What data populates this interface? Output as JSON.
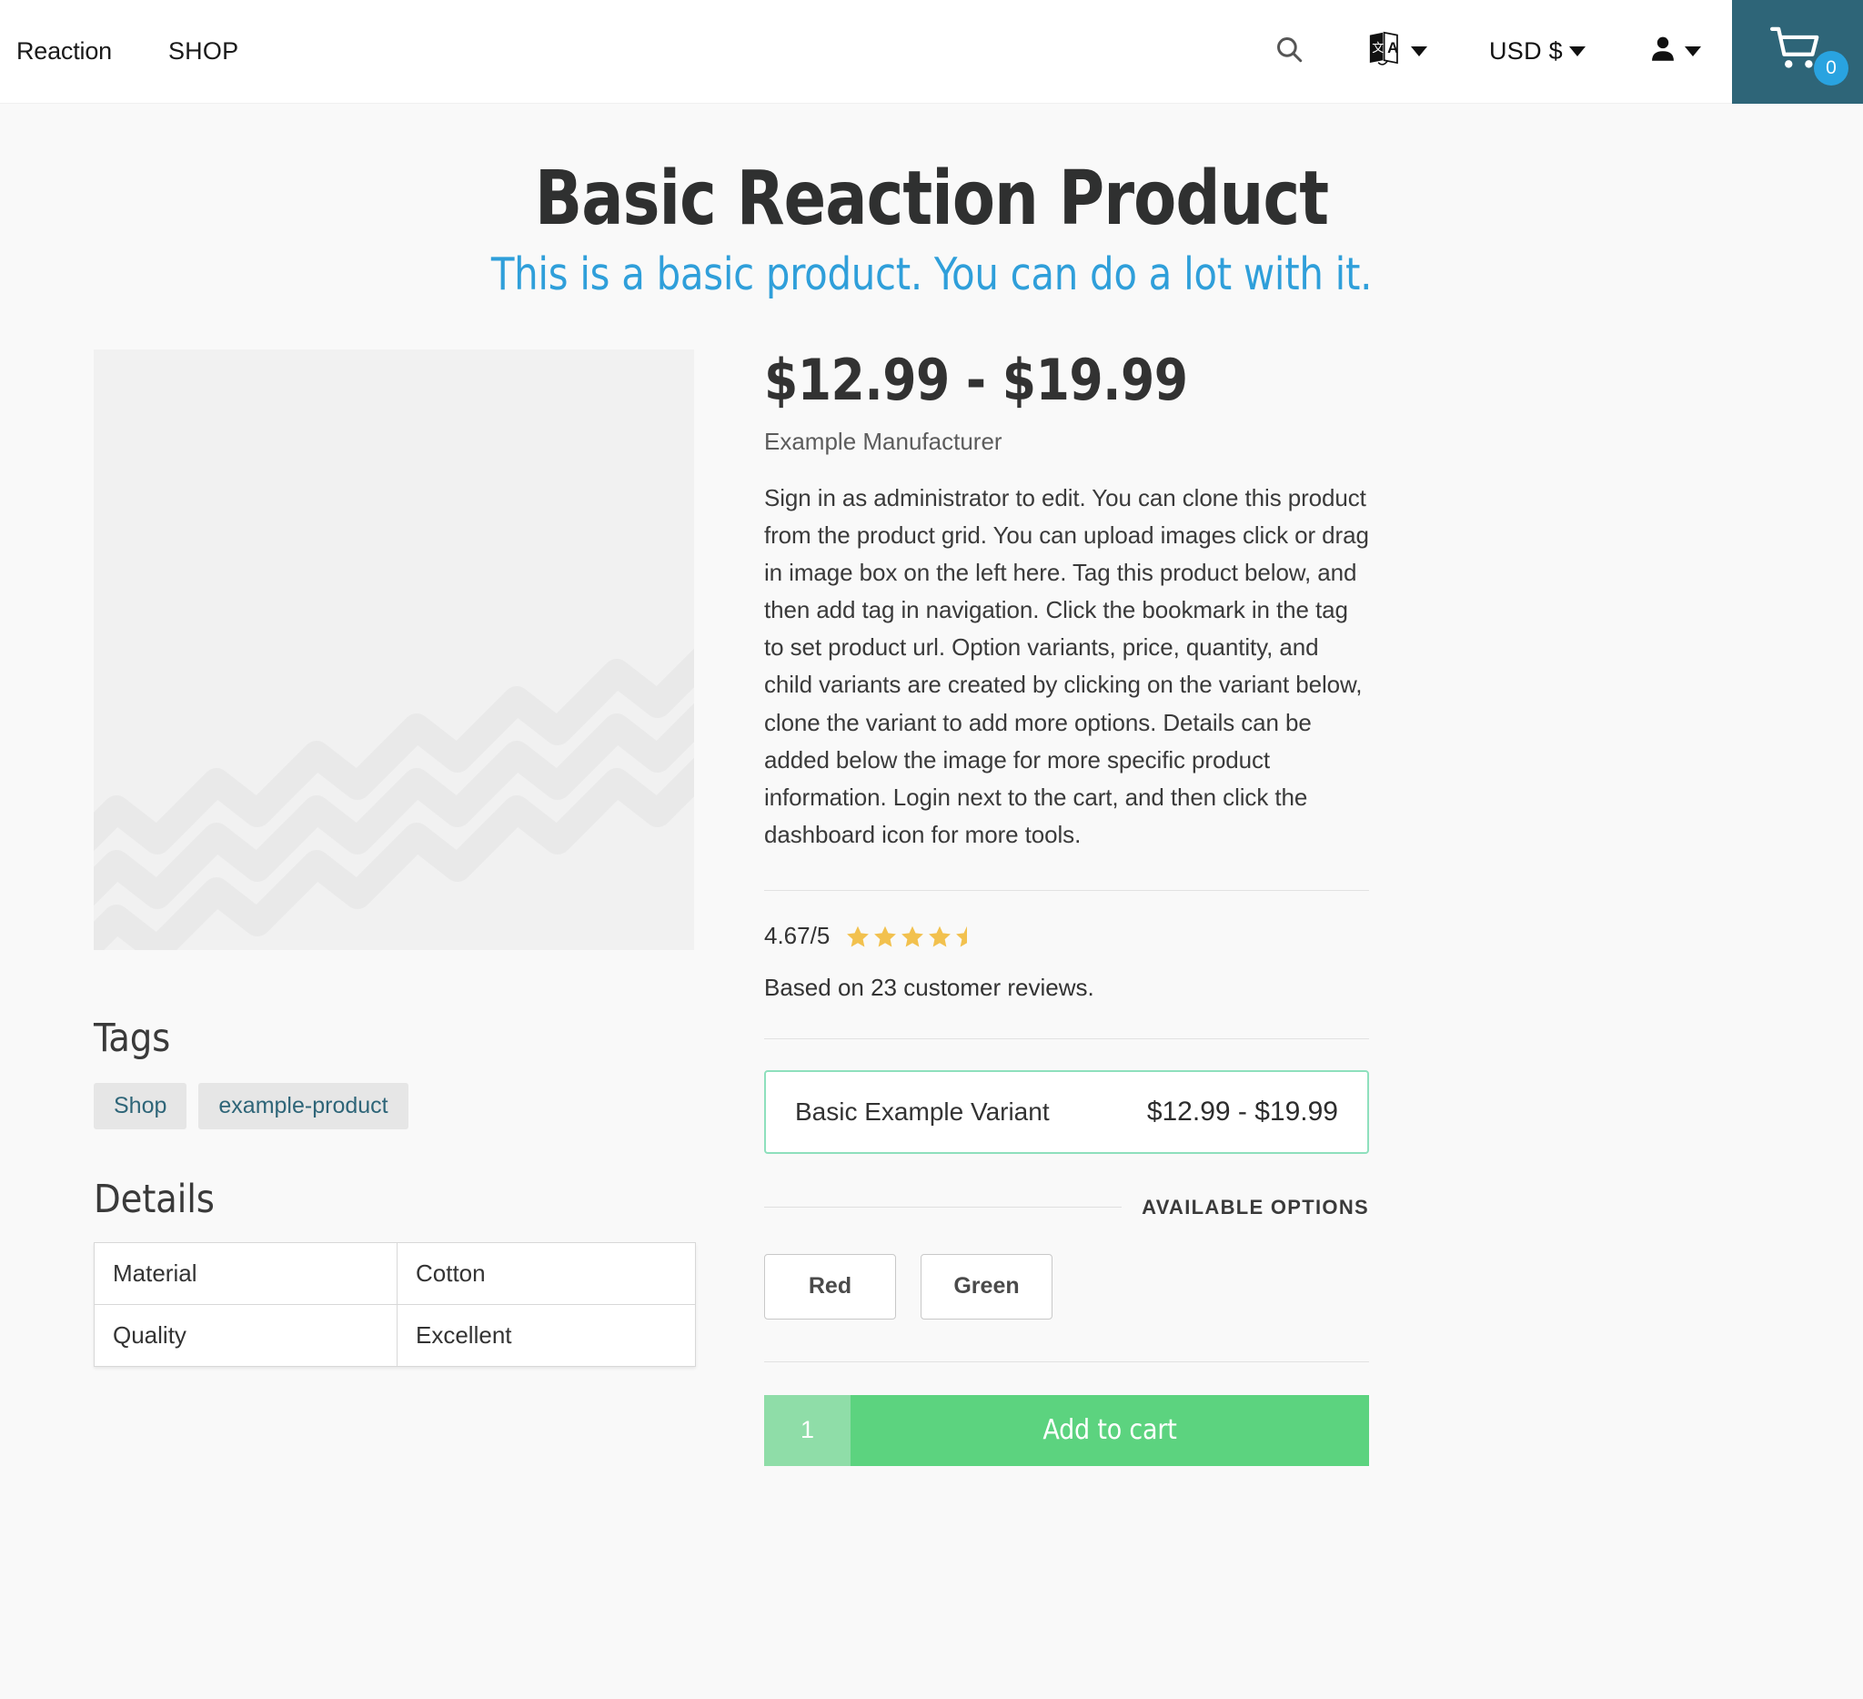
{
  "header": {
    "brand": "Reaction",
    "shop_link": "SHOP",
    "search_icon": "search-icon",
    "language_icon": "translate-icon",
    "currency_label": "USD $",
    "account_icon": "user-icon",
    "cart_icon": "shopping-cart-icon",
    "cart_count": "0",
    "cart_bg": "#2e6578",
    "badge_bg": "#29a3e0"
  },
  "product": {
    "title": "Basic Reaction Product",
    "subtitle": "This is a basic product. You can do a lot with it.",
    "price_range": "$12.99 - $19.99",
    "vendor": "Example Manufacturer",
    "description": "Sign in as administrator to edit. You can clone this product from the product grid. You can upload images click or drag in image box on the left here. Tag this product below, and then add tag in navigation. Click the bookmark in the tag to set product url. Option variants, price, quantity, and child variants are created by clicking on the variant below, clone the variant to add more options. Details can be added below the image for more specific product information. Login next to the cart, and then click the dashboard icon for more tools.",
    "media_placeholder": "product-image-placeholder"
  },
  "rating": {
    "value": "4.67/5",
    "stars_filled": 4,
    "stars_half": 1,
    "stars_total": 5,
    "star_color": "#f2c14e",
    "reviews_text": "Based on 23 customer reviews."
  },
  "variant": {
    "name": "Basic Example Variant",
    "price": "$12.99 - $19.99",
    "border_color": "#8ee0bd"
  },
  "options": {
    "divider_label": "AVAILABLE OPTIONS",
    "items": [
      {
        "label": "Red"
      },
      {
        "label": "Green"
      }
    ]
  },
  "cart_form": {
    "quantity": "1",
    "add_label": "Add to cart",
    "button_bg": "#5cd37f",
    "qty_bg": "#8fdda8"
  },
  "tags": {
    "heading": "Tags",
    "items": [
      {
        "label": "Shop"
      },
      {
        "label": "example-product"
      }
    ]
  },
  "details": {
    "heading": "Details",
    "rows": [
      {
        "key": "Material",
        "value": "Cotton"
      },
      {
        "key": "Quality",
        "value": "Excellent"
      }
    ]
  }
}
